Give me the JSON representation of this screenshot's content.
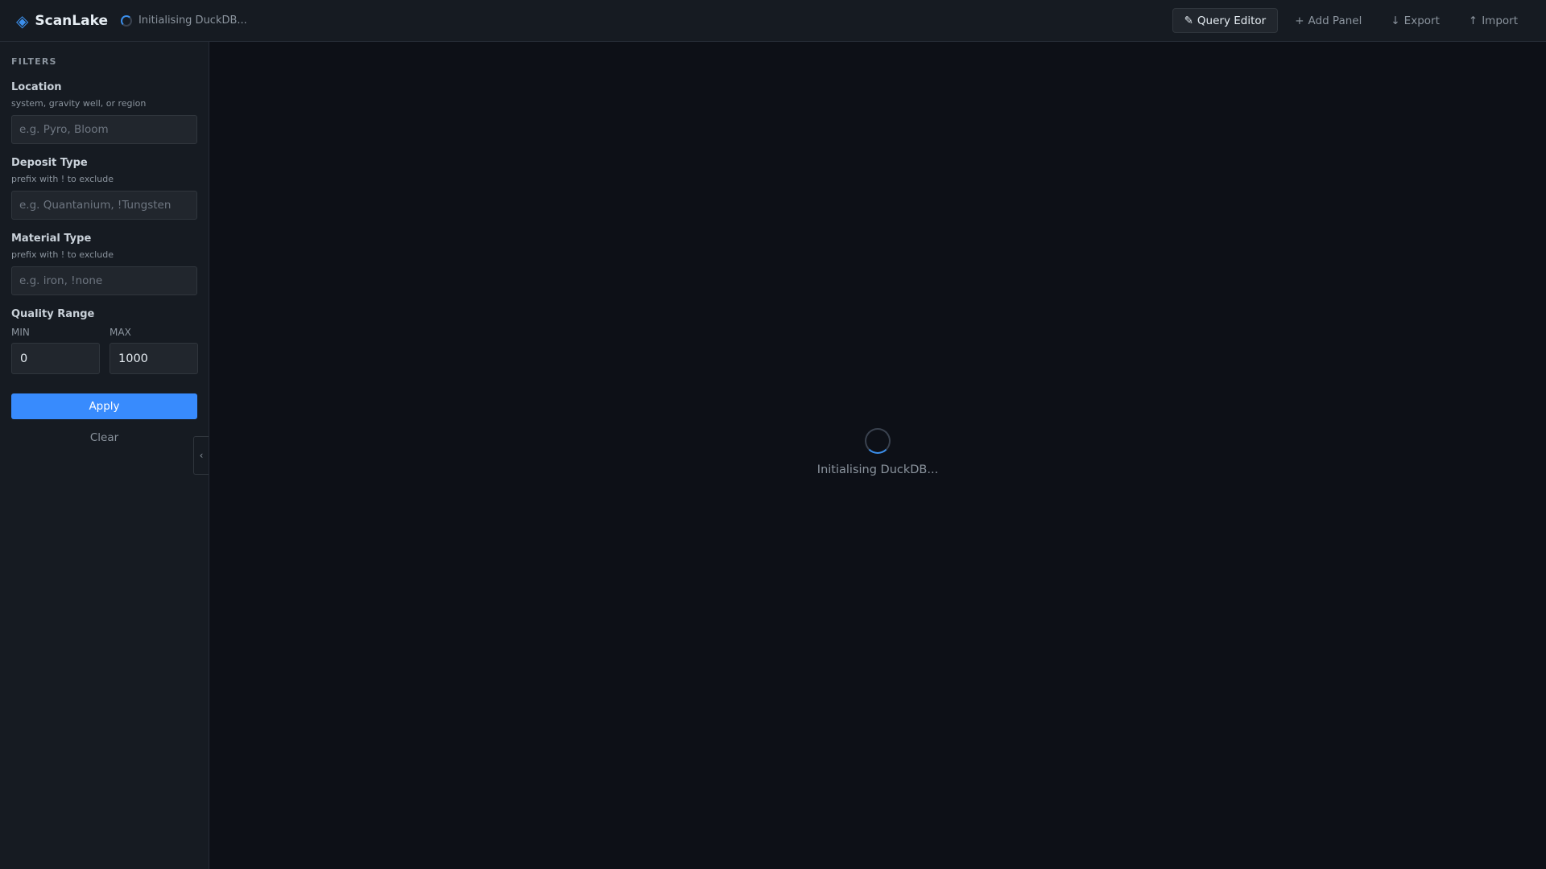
{
  "header": {
    "app_name": "ScanLake",
    "logo_icon": "◈",
    "status_text": "Initialising DuckDB...",
    "actions": [
      {
        "glyph": "✎",
        "label": "Query Editor",
        "active": true
      },
      {
        "glyph": "+",
        "label": "Add Panel"
      },
      {
        "glyph": "↓",
        "label": "Export"
      },
      {
        "glyph": "↑",
        "label": "Import"
      }
    ]
  },
  "sidebar": {
    "title": "FILTERS",
    "location": {
      "label": "Location",
      "hint": "system, gravity well, or region",
      "placeholder": "e.g. Pyro, Bloom"
    },
    "deposit": {
      "label": "Deposit Type",
      "hint": "prefix with ! to exclude",
      "placeholder": "e.g. Quantanium, !Tungsten"
    },
    "material": {
      "label": "Material Type",
      "hint": "prefix with ! to exclude",
      "placeholder": "e.g. iron, !none"
    },
    "quality": {
      "label": "Quality Range",
      "min_label": "MIN",
      "max_label": "MAX",
      "min_value": "0",
      "max_value": "1000"
    },
    "apply_label": "Apply",
    "clear_label": "Clear",
    "collapse_glyph": "‹"
  },
  "main": {
    "loading_text": "Initialising DuckDB..."
  },
  "colors": {
    "accent": "#388bfd",
    "background": "#0d1017",
    "panel": "#161b22"
  }
}
